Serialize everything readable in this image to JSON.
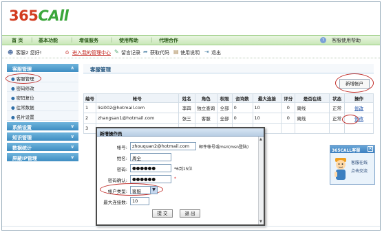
{
  "header": {
    "logo_num": "365",
    "logo_text": "CAll"
  },
  "nav": {
    "items": [
      "首  页",
      "基本功能",
      "增值服务",
      "使用帮助",
      "代理合作"
    ],
    "help": "客服使用帮助"
  },
  "userbar": {
    "hello": "客服2  您好!",
    "links": [
      "进入我的管理中心",
      "留言记录",
      "获取代码",
      "使用说明",
      "退出"
    ]
  },
  "sidebar": {
    "group1": "客服管理",
    "group1_items": [
      "客服管理",
      "密码修改",
      "密码复位",
      "往常数据",
      "名片设置"
    ],
    "group2": "系统设置",
    "group3": "知识管理",
    "group4": "数据统计",
    "group5": "屏蔽IP管理"
  },
  "main": {
    "title": "客服管理",
    "add_button": "新增帐户",
    "columns": [
      "编号",
      "帐号",
      "姓名",
      "角色",
      "权限",
      "咨询数",
      "最大连接",
      "评分",
      "是否在线",
      "状态",
      "操作"
    ],
    "rows": [
      [
        "1",
        "lisi002@hotmail.com",
        "李四",
        "独立查询",
        "全部",
        "0",
        "10",
        "0",
        "离线",
        "正常",
        "修改"
      ],
      [
        "2",
        "zhangsan1@hotmail.com",
        "张三",
        "客服",
        "全部",
        "0",
        "10",
        "0",
        "离线",
        "正常",
        "修改"
      ],
      [
        "3",
        "",
        "",
        "",
        "",
        "",
        "",
        "",
        "",
        "",
        ""
      ]
    ]
  },
  "modal": {
    "title": "新增操作员",
    "account_label": "帐号:",
    "account_value": "zhouquan2@hotmail.com",
    "account_hint": "邮件帐号或msn(msn登陆)",
    "name_label": "姓名:",
    "name_value": "周全",
    "password_label": "密码:",
    "password_value": "●●●●●●",
    "password_hint": "*6到15位",
    "confirm_label": "密码确认:",
    "confirm_value": "●●●●●●",
    "confirm_hint": "*",
    "type_label": "帐户类型:",
    "type_value": "客服",
    "maxconn_label": "最大连接数:",
    "maxconn_value": "10",
    "submit": "提 交",
    "quit": "退 出"
  },
  "chat": {
    "title": "365CALL客服",
    "line1": "客服在线",
    "line2": "点击交流"
  }
}
